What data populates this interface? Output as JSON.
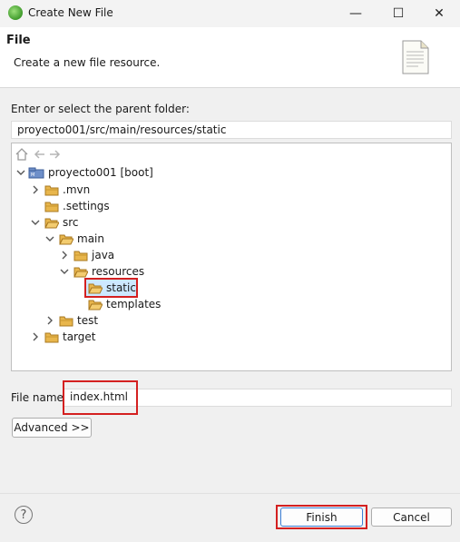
{
  "window": {
    "title": "Create New File",
    "minimize": "—",
    "maximize": "☐",
    "close": "✕"
  },
  "banner": {
    "title": "File",
    "description": "Create a new file resource."
  },
  "parent_folder": {
    "label": "Enter or select the parent folder:",
    "value": "proyecto001/src/main/resources/static"
  },
  "tree": {
    "nodes": [
      {
        "label": "proyecto001 [boot]"
      },
      {
        "label": ".mvn"
      },
      {
        "label": ".settings"
      },
      {
        "label": "src"
      },
      {
        "label": "main"
      },
      {
        "label": "java"
      },
      {
        "label": "resources"
      },
      {
        "label": "static"
      },
      {
        "label": "templates"
      },
      {
        "label": "test"
      },
      {
        "label": "target"
      }
    ]
  },
  "file_name": {
    "label": "File name:",
    "value": "index.html"
  },
  "buttons": {
    "advanced": "Advanced >>",
    "finish": "Finish",
    "cancel": "Cancel",
    "help": "?"
  },
  "colors": {
    "highlight": "#d42020",
    "selection": "#cce8ff",
    "folder": "#e8b64c"
  }
}
